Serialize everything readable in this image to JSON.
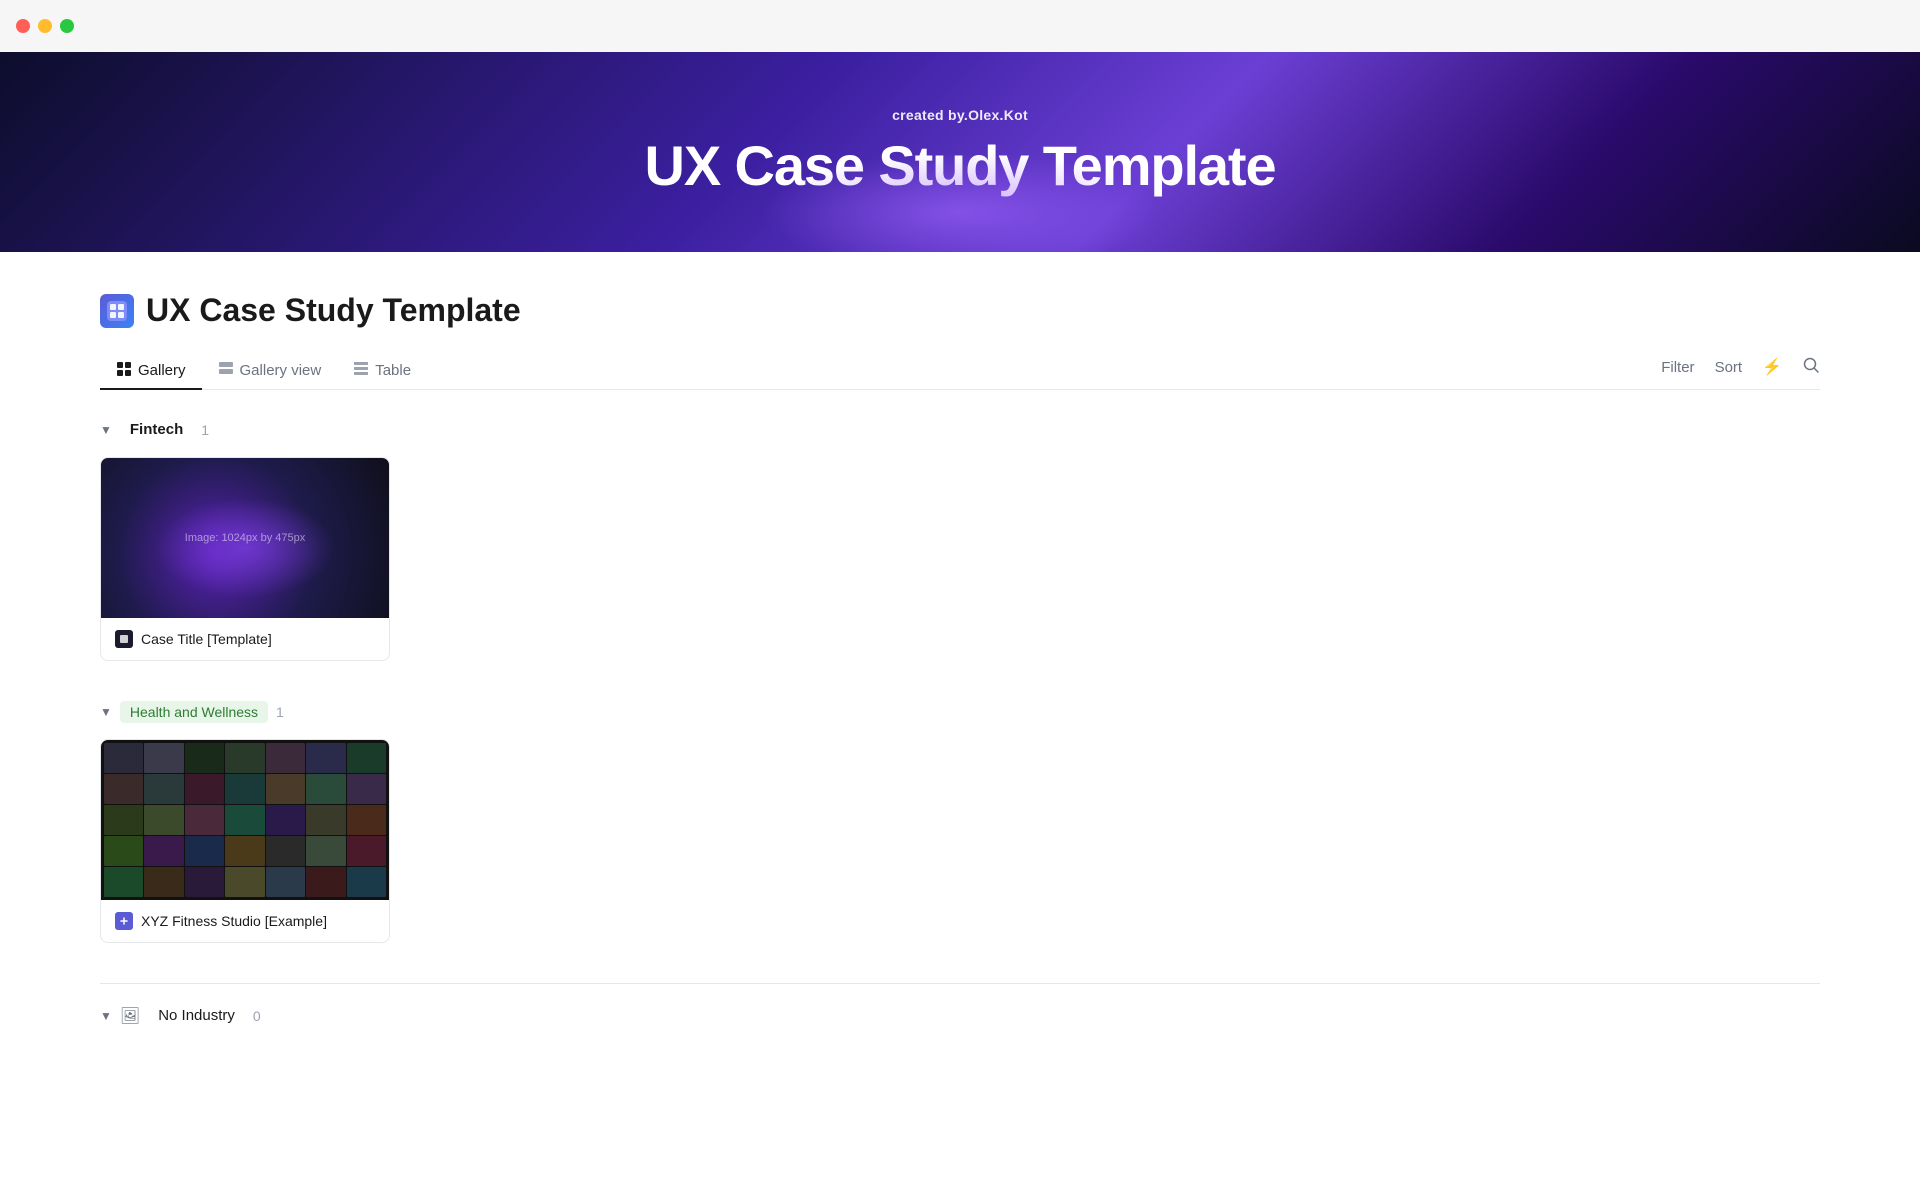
{
  "titlebar": {
    "traffic_lights": [
      "close",
      "minimize",
      "maximize"
    ]
  },
  "hero": {
    "created_by_label": "created by",
    "created_by_author": ".Olex.Kot",
    "title": "UX Case Study Template"
  },
  "page": {
    "icon": "🔷",
    "title": "UX Case Study Template"
  },
  "tabs": {
    "items": [
      {
        "id": "gallery",
        "label": "Gallery",
        "icon": "⊞",
        "active": true
      },
      {
        "id": "gallery-view",
        "label": "Gallery view",
        "icon": "⊟",
        "active": false
      },
      {
        "id": "table",
        "label": "Table",
        "icon": "⊞",
        "active": false
      }
    ],
    "actions": {
      "filter_label": "Filter",
      "sort_label": "Sort"
    }
  },
  "groups": [
    {
      "id": "fintech",
      "label": "Fintech",
      "tag_type": "plain",
      "count": 1,
      "cards": [
        {
          "id": "case-template",
          "image_type": "fintech",
          "image_text": "Image: 1024px by 475px",
          "title": "Case Title [Template]",
          "icon_type": "dark"
        }
      ]
    },
    {
      "id": "health-wellness",
      "label": "Health and Wellness",
      "tag_type": "green",
      "count": 1,
      "cards": [
        {
          "id": "xyz-fitness",
          "image_type": "fitness",
          "image_text": "",
          "title": "XYZ Fitness Studio [Example]",
          "icon_type": "purple"
        }
      ]
    },
    {
      "id": "no-industry",
      "label": "No Industry",
      "tag_type": "plain",
      "count": 0,
      "icon": "🖼",
      "cards": []
    }
  ]
}
